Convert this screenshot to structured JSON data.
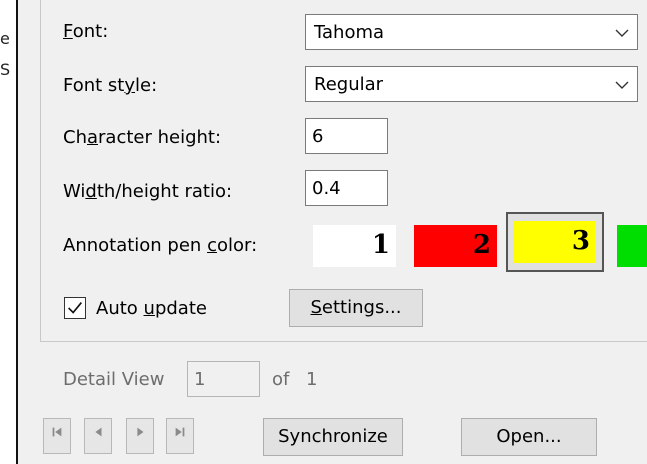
{
  "edge_text": {
    "line1": "e",
    "line2": "S"
  },
  "font": {
    "label_pre": "",
    "label_u": "F",
    "label_post": "ont:",
    "value": "Tahoma"
  },
  "font_style": {
    "label_pre": "Font st",
    "label_u": "y",
    "label_post": "le:",
    "value": "Regular"
  },
  "char_height": {
    "label_pre": "Ch",
    "label_u": "a",
    "label_post": "racter height:",
    "value": "6"
  },
  "width_ratio": {
    "label_pre": "Wi",
    "label_u": "d",
    "label_post": "th/height ratio:",
    "value": "0.4"
  },
  "pen_color": {
    "label_pre": "Annotation pen ",
    "label_u": "c",
    "label_post": "olor:",
    "swatches": [
      {
        "label": "1",
        "color": "#ffffff"
      },
      {
        "label": "2",
        "color": "#ff0000"
      },
      {
        "label": "3",
        "color": "#ffff00"
      },
      {
        "label": "",
        "color": "#00dd00"
      }
    ]
  },
  "auto_update": {
    "label_pre": "Auto ",
    "label_u": "u",
    "label_post": "pdate",
    "checked": true
  },
  "settings_button": {
    "label_pre": "",
    "label_u": "S",
    "label_post": "ettings..."
  },
  "detail_view": {
    "label": "Detail View",
    "value": "1",
    "of_label": "of",
    "total": "1"
  },
  "nav": {
    "first_icon": "first-page-icon",
    "prev_icon": "previous-page-icon",
    "next_icon": "next-page-icon",
    "last_icon": "last-page-icon"
  },
  "synchronize_button": {
    "label": "Synchronize"
  },
  "open_button": {
    "label": "Open..."
  }
}
